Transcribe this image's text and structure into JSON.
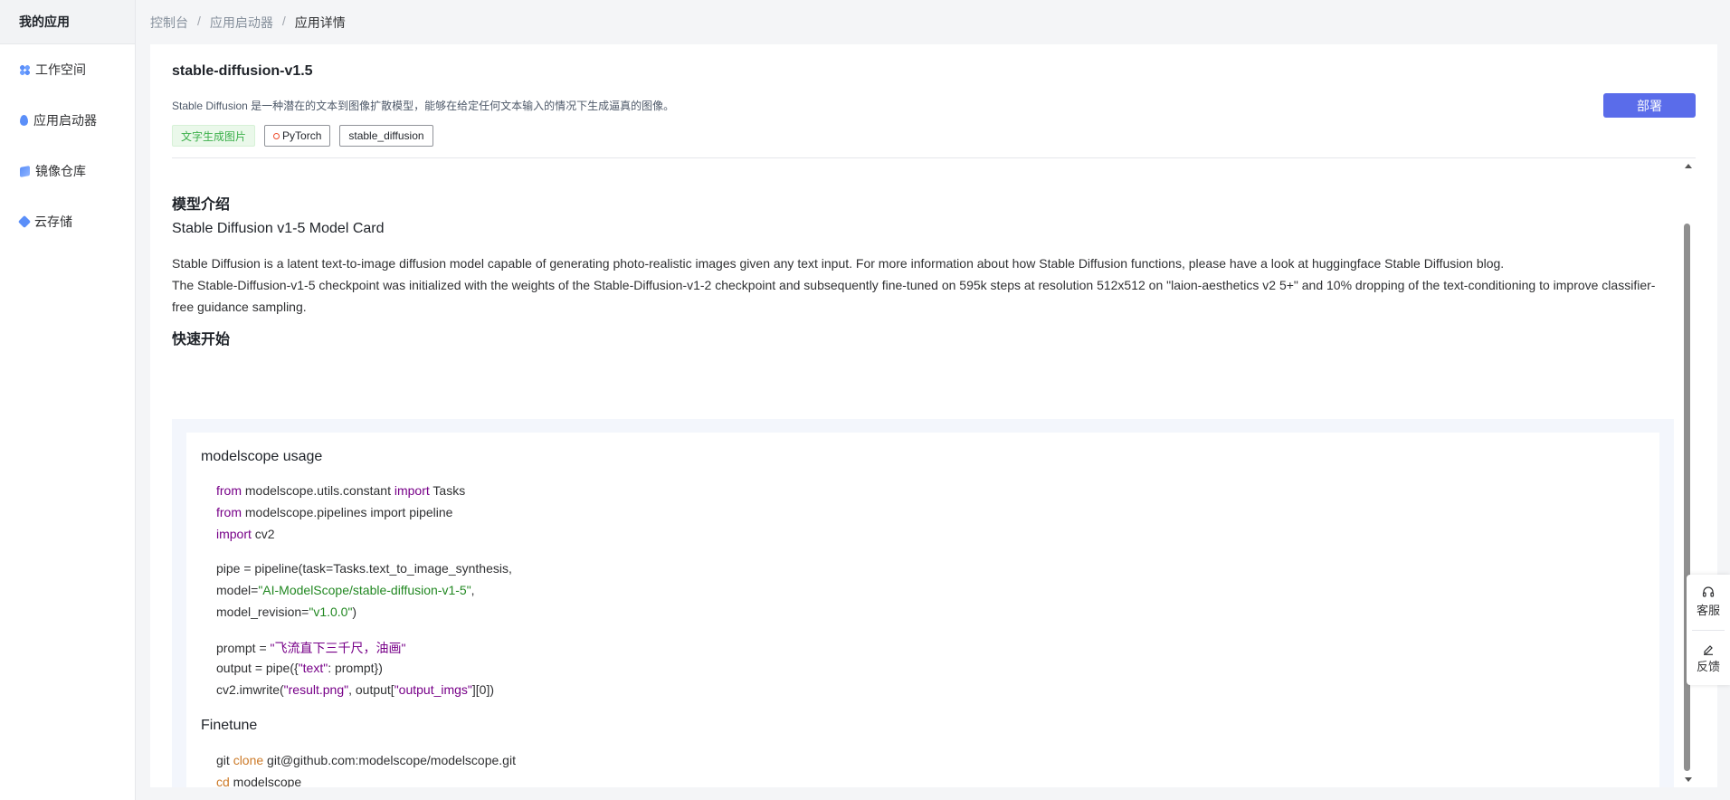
{
  "sidebar": {
    "title": "我的应用",
    "items": [
      {
        "label": "工作空间",
        "icon": "workspace-icon"
      },
      {
        "label": "应用启动器",
        "icon": "rocket-icon"
      },
      {
        "label": "镜像仓库",
        "icon": "cube-icon"
      },
      {
        "label": "云存储",
        "icon": "cloud-storage-icon"
      }
    ]
  },
  "breadcrumb": {
    "items": [
      "控制台",
      "应用启动器",
      "应用详情"
    ],
    "separator": "/"
  },
  "app": {
    "title": "stable-diffusion-v1.5",
    "description": "Stable Diffusion 是一种潜在的文本到图像扩散模型，能够在给定任何文本输入的情况下生成逼真的图像。",
    "deploy_label": "部署",
    "accent_color": "#5a6cea",
    "tags": [
      "文字生成图片",
      "PyTorch",
      "stable_diffusion"
    ]
  },
  "content": {
    "intro_heading": "模型介绍",
    "card_title": "Stable Diffusion v1-5 Model Card",
    "para1": "Stable Diffusion is a latent text-to-image diffusion model capable of generating photo-realistic images given any text input. For more information about how Stable Diffusion functions, please have a look at huggingface Stable Diffusion blog.",
    "para2": "The Stable-Diffusion-v1-5 checkpoint was initialized with the weights of the Stable-Diffusion-v1-2 checkpoint and subsequently fine-tuned on 595k steps at resolution 512x512 on \"laion-aesthetics v2 5+\" and 10% dropping of the text-conditioning to improve classifier-free guidance sampling.",
    "quickstart_heading": "快速开始",
    "usage_heading": "modelscope usage",
    "code": {
      "l1_kw1": "from",
      "l1_mid": " modelscope.utils.constant ",
      "l1_kw2": "import",
      "l1_end": " Tasks",
      "l2_kw": "from",
      "l2_rest": " modelscope.pipelines import pipeline",
      "l3_kw": "import",
      "l3_rest": " cv2",
      "l4": "pipe = pipeline(task=Tasks.text_to_image_synthesis,",
      "l5_pre": "model=",
      "l5_str": "\"AI-ModelScope/stable-diffusion-v1-5\"",
      "l5_post": ",",
      "l6_pre": "model_revision=",
      "l6_str": "\"v1.0.0\"",
      "l6_post": ")",
      "l7_pre": "prompt = ",
      "l7_str": "\"飞流直下三千尺，油画\"",
      "l8_pre": "output = pipe({",
      "l8_str": "\"text\"",
      "l8_post": ": prompt})",
      "l9_pre": "cv2.imwrite(",
      "l9_str1": "\"result.png\"",
      "l9_mid": ", output[",
      "l9_str2": "\"output_imgs\"",
      "l9_post": "][0])"
    },
    "finetune_heading": "Finetune",
    "finetune": {
      "l1_pre": "git ",
      "l1_kw": "clone",
      "l1_post": " git@github.com:modelscope/modelscope.git",
      "l2_kw": "cd",
      "l2_post": " modelscope"
    }
  },
  "float_actions": {
    "service_label": "客服",
    "feedback_label": "反馈"
  }
}
